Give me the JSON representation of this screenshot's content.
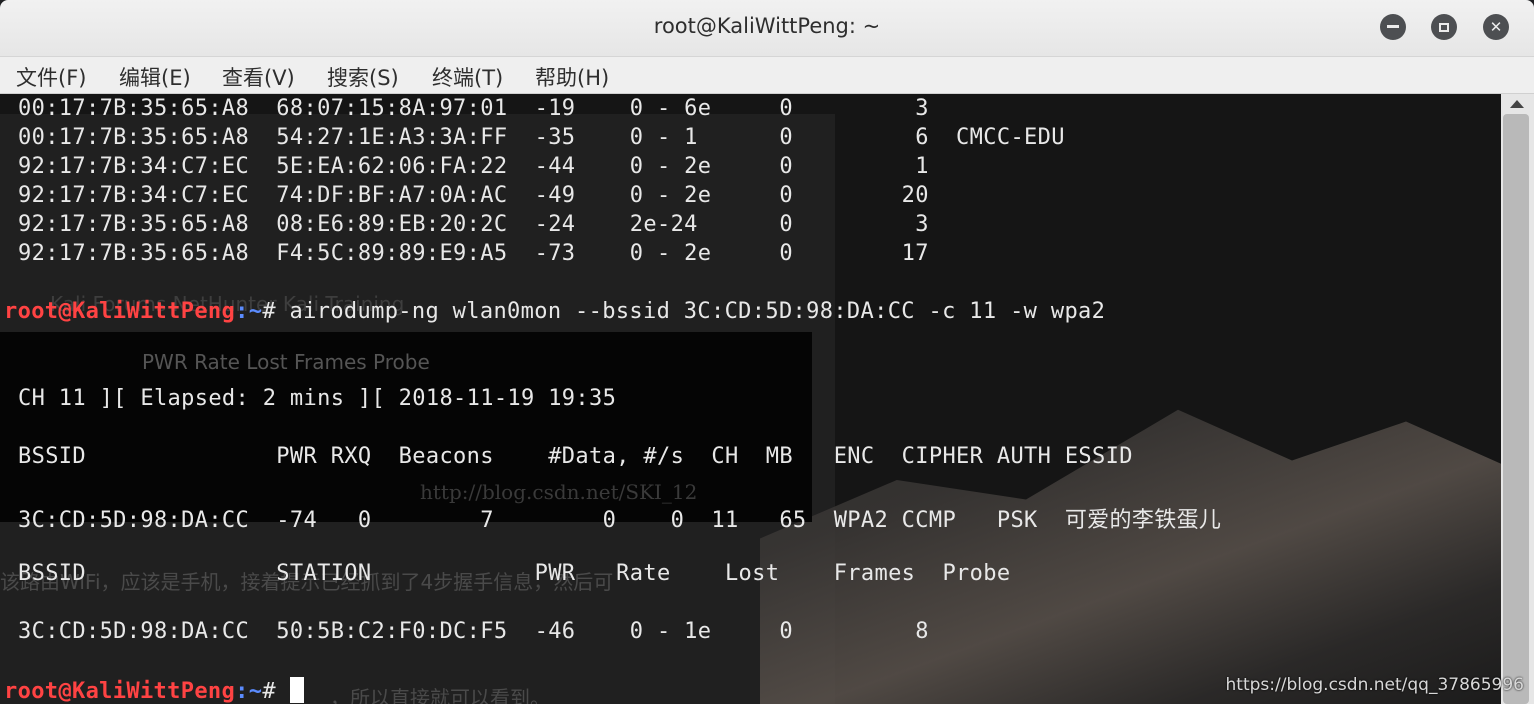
{
  "window": {
    "title": "root@KaliWittPeng: ~",
    "controls": [
      "minimize-icon",
      "maximize-icon",
      "close-icon"
    ]
  },
  "menu": {
    "items": [
      "文件(F)",
      "编辑(E)",
      "查看(V)",
      "搜索(S)",
      "终端(T)",
      "帮助(H)"
    ]
  },
  "terminal": {
    "lines": {
      "l1": "00:17:7B:35:65:A8  68:07:15:8A:97:01  -19    0 - 6e     0         3",
      "l2": "00:17:7B:35:65:A8  54:27:1E:A3:3A:FF  -35    0 - 1      0         6  CMCC-EDU",
      "l3": "92:17:7B:34:C7:EC  5E:EA:62:06:FA:22  -44    0 - 2e     0         1",
      "l4": "92:17:7B:34:C7:EC  74:DF:BF:A7:0A:AC  -49    0 - 2e     0        20",
      "l5": "92:17:7B:35:65:A8  08:E6:89:EB:20:2C  -24    2e-24      0         3",
      "l6": "92:17:7B:35:65:A8  F4:5C:89:89:E9:A5  -73    0 - 2e     0        17",
      "status": "CH 11 ][ Elapsed: 2 mins ][ 2018-11-19 19:35",
      "ap_header": "BSSID              PWR RXQ  Beacons    #Data, #/s  CH  MB   ENC  CIPHER AUTH ESSID",
      "ap_row": "3C:CD:5D:98:DA:CC  -74   0        7        0    0  11   65  WPA2 CCMP   PSK  可爱的李铁蛋儿",
      "sta_header": "BSSID              STATION            PWR   Rate    Lost    Frames  Probe",
      "sta_row": "3C:CD:5D:98:DA:CC  50:5B:C2:F0:DC:F5  -46    0 - 1e     0         8"
    },
    "prompt1": {
      "user": "root@KaliWittPeng",
      "path": ":~",
      "hash": "# ",
      "command": "airodump-ng wlan0mon --bssid 3C:CD:5D:98:DA:CC -c 11 -w wpa2"
    },
    "prompt2": {
      "user": "root@KaliWittPeng",
      "path": ":~",
      "hash": "# "
    }
  },
  "background_text": {
    "bookmarks": "Kali Forums     NetHunter     Kali Training",
    "columns": "PWR    Rate     Lost     Frames   Probe",
    "url": "http://blog.csdn.net/SKI_12",
    "caption1": "该路由WiFi，应该是手机，接着提示已经抓到了4步握手信息，然后可",
    "caption2": "，所以直接就可以看到。"
  },
  "watermark": "https://blog.csdn.net/qq_37865996"
}
